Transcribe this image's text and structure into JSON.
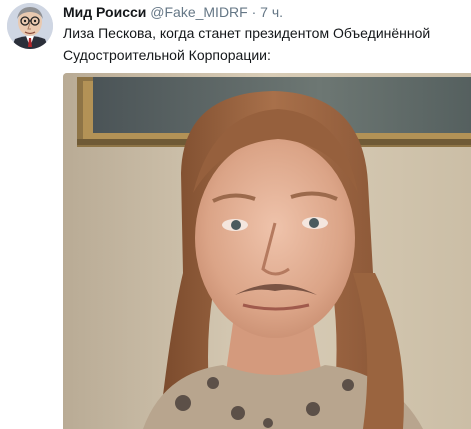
{
  "tweet": {
    "author_name": "Мид Роисси",
    "author_handle": "@Fake_MIDRF",
    "separator": "·",
    "timestamp": "7 ч.",
    "text": "Лиза Пескова, когда станет президентом Объединённой Судостроительной Корпорации:"
  },
  "icons": {
    "avatar": "caricature-avatar",
    "media": "portrait-photo"
  }
}
